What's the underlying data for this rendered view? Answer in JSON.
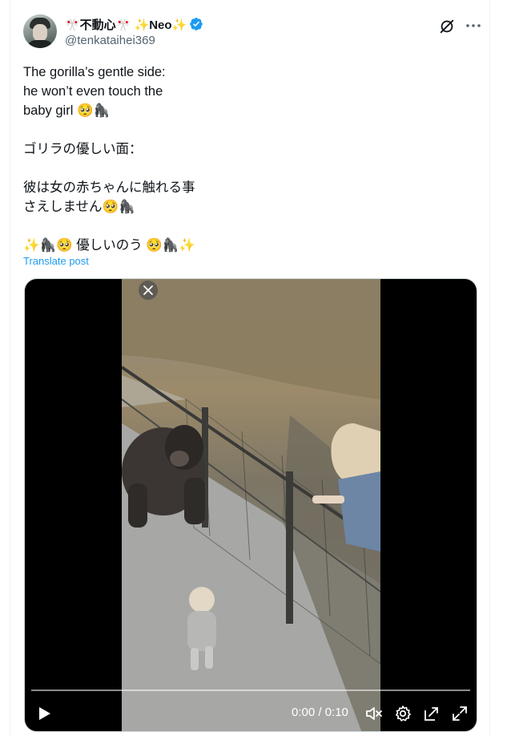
{
  "author": {
    "display_name": "🎌不動心🎌 ✨Neo✨",
    "handle": "@tenkataihei369"
  },
  "tweet": {
    "lines": [
      "The gorilla’s gentle side:",
      "he won’t even touch the",
      "baby girl 🥺🦍",
      "",
      "ゴリラの優しい面：",
      "",
      "彼は女の赤ちゃんに触れる事",
      "さえしません🥺🦍",
      "",
      "✨🦍🥺  優しいのう 🥺🦍✨"
    ],
    "translate_label": "Translate post"
  },
  "video": {
    "time": "0:00 / 0:10",
    "progress": 0
  },
  "colors": {
    "link": "#1d9bf0",
    "verified": "#1d9bf0",
    "secondary_text": "#536471"
  },
  "icons": [
    "verified-badge-icon",
    "grok-icon",
    "more-icon",
    "close-icon",
    "play-icon",
    "volume-icon",
    "settings-icon",
    "dock-icon",
    "fullscreen-icon"
  ]
}
